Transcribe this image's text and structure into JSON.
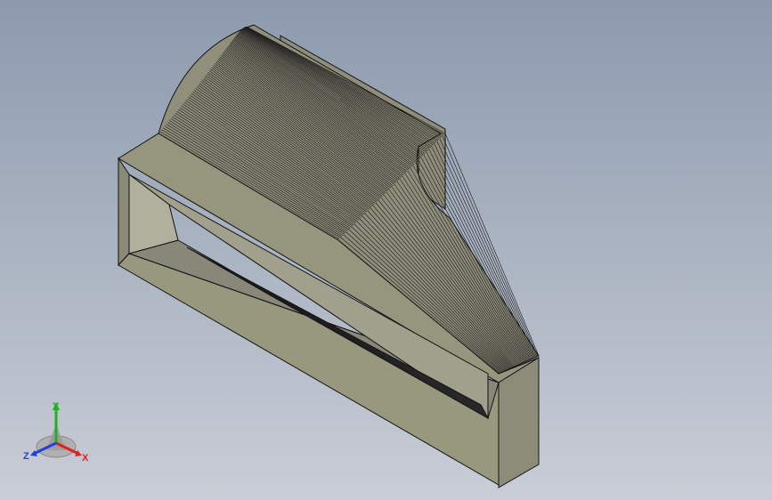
{
  "viewport": {
    "background_top": "#8d9aae",
    "background_bottom": "#c9cdd6",
    "part_face_color": "#93937f",
    "part_dark_face_color": "#7d7d6c",
    "edge_color": "#111111"
  },
  "triad": {
    "x_label": "X",
    "y_label": "Y",
    "z_label": "Z",
    "x_color": "#e02020",
    "y_color": "#20b020",
    "z_color": "#2040e0"
  }
}
